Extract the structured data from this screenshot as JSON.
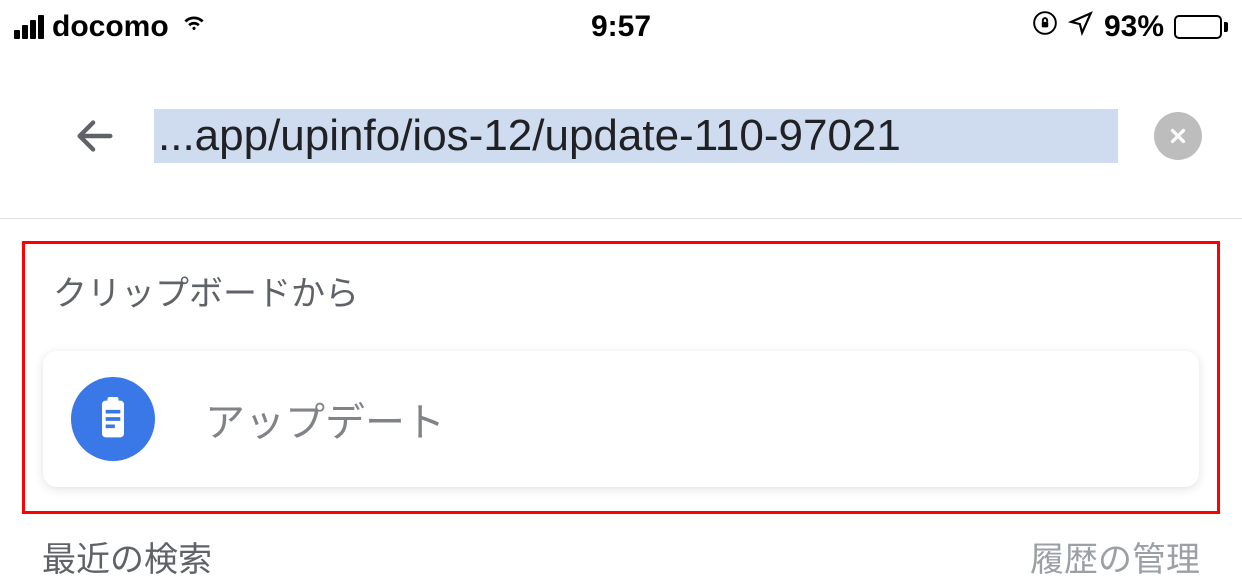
{
  "status_bar": {
    "carrier": "docomo",
    "time": "9:57",
    "battery_percent": "93%"
  },
  "address_bar": {
    "url": "...app/upinfo/ios-12/update-110-97021"
  },
  "clipboard": {
    "section_label": "クリップボードから",
    "item_text": "アップデート"
  },
  "bottom": {
    "recent_searches_label": "最近の検索",
    "history_management_label": "履歴の管理"
  }
}
